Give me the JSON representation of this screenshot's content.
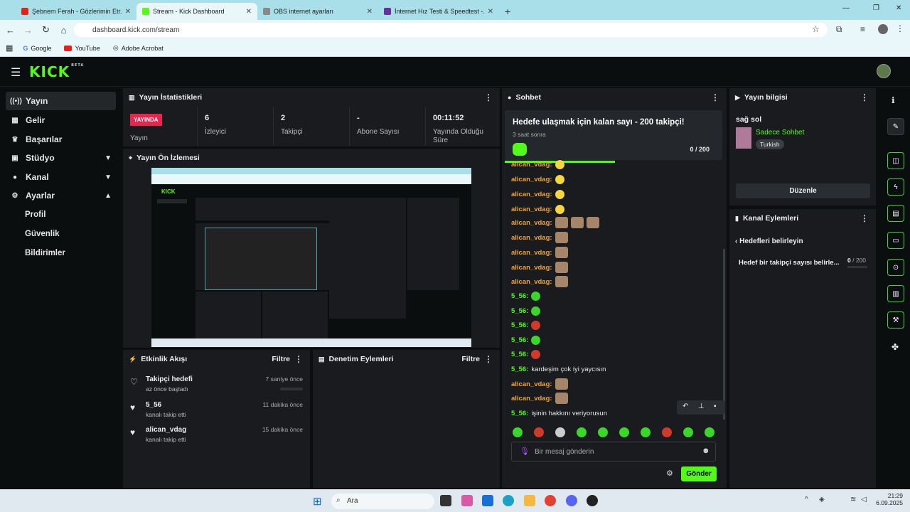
{
  "browser": {
    "tabs": [
      {
        "title": "Şebnem Ferah - Gözlerimin Etr...",
        "color": "#e62117"
      },
      {
        "title": "Stream - Kick Dashboard",
        "color": "#53fc18"
      },
      {
        "title": "OBS internet ayarları",
        "color": "#888888"
      },
      {
        "title": "İnternet Hız Testi & Speedtest -...",
        "color": "#6b2fa0"
      }
    ],
    "url": "dashboard.kick.com/stream",
    "bookmarks": [
      "Google",
      "YouTube",
      "Adobe Acrobat"
    ]
  },
  "header": {
    "logo": "KICK",
    "logo_badge": "BETA"
  },
  "sidebar": {
    "items": [
      {
        "label": "Yayın",
        "icon": "(•)"
      },
      {
        "label": "Gelir",
        "icon": "▦"
      },
      {
        "label": "Başarılar",
        "icon": "🏆"
      },
      {
        "label": "Stüdyo",
        "icon": "▣"
      },
      {
        "label": "Kanal",
        "icon": "👤"
      },
      {
        "label": "Ayarlar",
        "icon": "⚙"
      }
    ],
    "subitems": [
      "Profil",
      "Güvenlik",
      "Bildirimler"
    ]
  },
  "stats": {
    "title": "Yayın İstatistikleri",
    "live_badge": "YAYINDA",
    "items": [
      {
        "value": "",
        "label": "Yayın"
      },
      {
        "value": "6",
        "label": "İzleyici"
      },
      {
        "value": "2",
        "label": "Takipçi"
      },
      {
        "value": "-",
        "label": "Abone Sayısı"
      },
      {
        "value": "00:11:52",
        "label": "Yayında Olduğu Süre"
      }
    ]
  },
  "preview": {
    "title": "Yayın Ön İzlemesi"
  },
  "activity": {
    "title": "Etkinlik Akışı",
    "filter": "Filtre",
    "items": [
      {
        "name": "Takipçi hedefi",
        "sub": "az önce başladı",
        "time": "7 saniye önce"
      },
      {
        "name": "5_56",
        "sub": "kanalı takip etti",
        "time": "11 dakika önce"
      },
      {
        "name": "alican_vdag",
        "sub": "kanalı takip etti",
        "time": "15 dakika önce"
      }
    ]
  },
  "moderation": {
    "title": "Denetim Eylemleri",
    "filter": "Filtre"
  },
  "chat": {
    "title": "Sohbet",
    "goal_title": "Hedefe ulaşmak için kalan sayı - 200 takipçi!",
    "goal_sub": "3 saat sonra",
    "goal_count": "0 / 200",
    "messages": [
      {
        "user": "alican_vdag:",
        "text": ""
      },
      {
        "user": "alican_vdag:",
        "text": ""
      },
      {
        "user": "alican_vdag:",
        "text": ""
      },
      {
        "user": "alican_vdag:",
        "text": ""
      },
      {
        "user": "alican_vdag:",
        "text": ""
      },
      {
        "user": "alican_vdag:",
        "text": ""
      },
      {
        "user": "alican_vdag:",
        "text": ""
      },
      {
        "user": "alican_vdag:",
        "text": ""
      },
      {
        "user": "alican_vdag:",
        "text": ""
      },
      {
        "user": "5_56:",
        "text": ""
      },
      {
        "user": "5_56:",
        "text": ""
      },
      {
        "user": "5_56:",
        "text": ""
      },
      {
        "user": "5_56:",
        "text": ""
      },
      {
        "user": "5_56:",
        "text": ""
      },
      {
        "user": "5_56:",
        "text": "kardeşim çok iyi yaycısın"
      },
      {
        "user": "alican_vdag:",
        "text": ""
      },
      {
        "user": "alican_vdag:",
        "text": ""
      },
      {
        "user": "5_56:",
        "text": "işinin hakkını veriyorusun"
      }
    ],
    "placeholder": "Bir mesaj gönderin",
    "send": "Gönder"
  },
  "stream_info": {
    "title": "Yayın bilgisi",
    "stream_title": "sağ sol",
    "category": "Sadece Sohbet",
    "language": "Turkish",
    "edit": "Düzenle"
  },
  "channel_actions": {
    "title": "Kanal Eylemleri",
    "back_label": "Hedefleri belirleyin",
    "goal_label": "Hedef bir takipçi sayısı belirle...",
    "goal_value": "0",
    "goal_total": "/ 200"
  },
  "taskbar": {
    "search": "Ara",
    "time": "21:29",
    "date": "6.09.2025"
  }
}
